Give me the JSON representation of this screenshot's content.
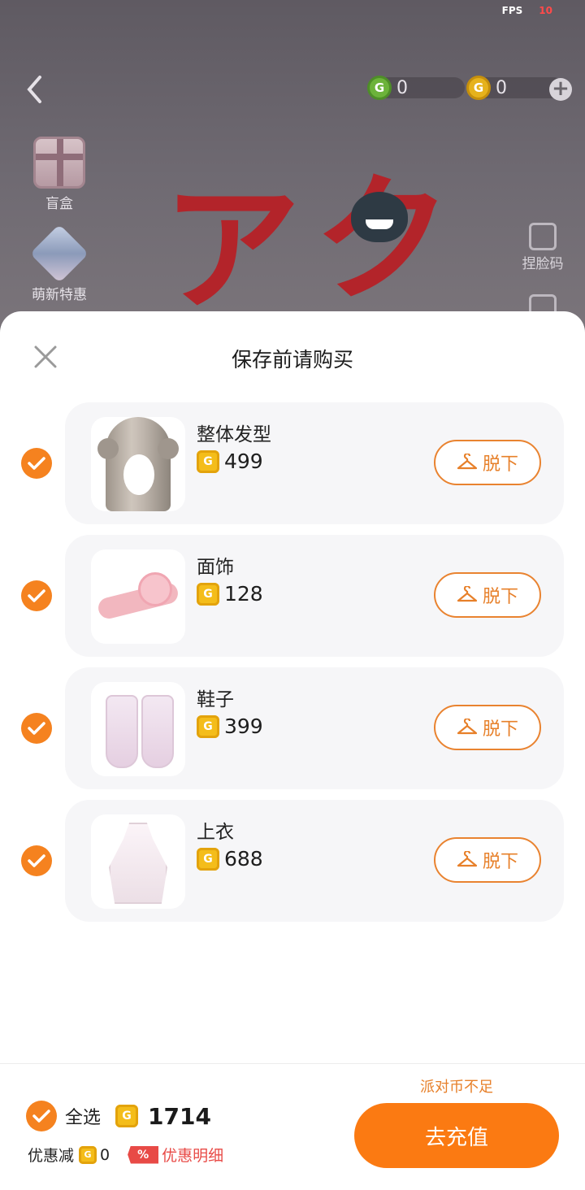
{
  "status": {
    "fps_label": "FPS",
    "fps_value": "10"
  },
  "currency": {
    "green_coin_value": "0",
    "gold_coin_value": "0"
  },
  "side_menu": [
    {
      "label": "盲盒"
    },
    {
      "label": "萌新特惠"
    }
  ],
  "right_tools": [
    {
      "label": "捏脸码"
    }
  ],
  "sheet": {
    "title": "保存前请购买",
    "items": [
      {
        "name": "整体发型",
        "price": "499",
        "action": "脱下",
        "checked": true
      },
      {
        "name": "面饰",
        "price": "128",
        "action": "脱下",
        "checked": true
      },
      {
        "name": "鞋子",
        "price": "399",
        "action": "脱下",
        "checked": true
      },
      {
        "name": "上衣",
        "price": "688",
        "action": "脱下",
        "checked": true
      }
    ]
  },
  "footer": {
    "select_all_label": "全选",
    "total": "1714",
    "discount_label": "优惠减",
    "discount_value": "0",
    "discount_badge": "%",
    "discount_detail_label": "优惠明细",
    "insufficient_text": "派对币不足",
    "recharge_label": "去充值"
  },
  "colors": {
    "accent": "#f5821f",
    "coin": "#f4bd1a",
    "card_bg": "#f6f6f8",
    "discount_red": "#e84a46"
  }
}
